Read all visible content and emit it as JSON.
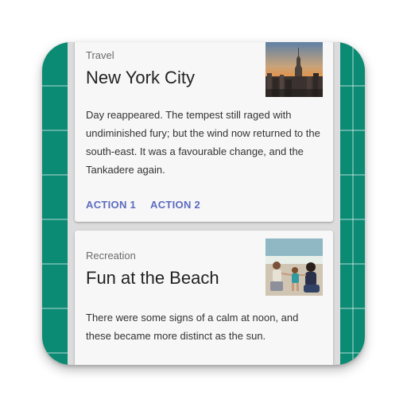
{
  "cards": [
    {
      "category": "Travel",
      "title": "New York City",
      "image": "new-york-skyline-image",
      "body": "Day reappeared. The tempest still raged with undiminished fury; but the wind now returned to the south-east. It was a favourable change, and the Tankadere again.",
      "actions": [
        "ACTION 1",
        "ACTION 2"
      ]
    },
    {
      "category": "Recreation",
      "title": "Fun at the Beach",
      "image": "beach-family-image",
      "body": "There were some signs of a calm at noon, and these became more distinct as the sun."
    }
  ],
  "colors": {
    "icon_background": "#0b8a74",
    "card_background": "#f7f7f7",
    "action_text": "#5c6bc0"
  }
}
